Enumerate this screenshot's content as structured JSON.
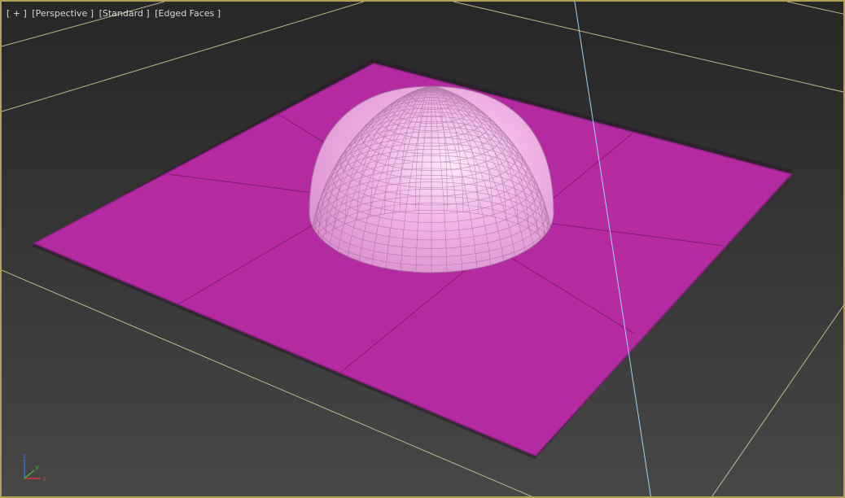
{
  "viewport": {
    "labels": {
      "menu": "[ + ]",
      "view": "[Perspective ]",
      "shading": "[Standard ]",
      "display": "[Edged Faces ]"
    },
    "border_color": "#b3a15a",
    "grid_color": "#d6cf9e",
    "view_axis_line_color": "#9fd4f0"
  },
  "scene": {
    "plane": {
      "color": "#b32aa1",
      "edge_color": "#7a1a6e",
      "segments": 3
    },
    "hemisphere": {
      "color": "#ee9de0",
      "highlight_color": "#fde8f9",
      "wire_color": "#8a5a85"
    }
  },
  "axis_gizmo": {
    "x_label": "x",
    "y_label": "y",
    "z_label": "z",
    "x_color": "#d83a3a",
    "y_color": "#3fae3f",
    "z_color": "#3a6fd8"
  }
}
